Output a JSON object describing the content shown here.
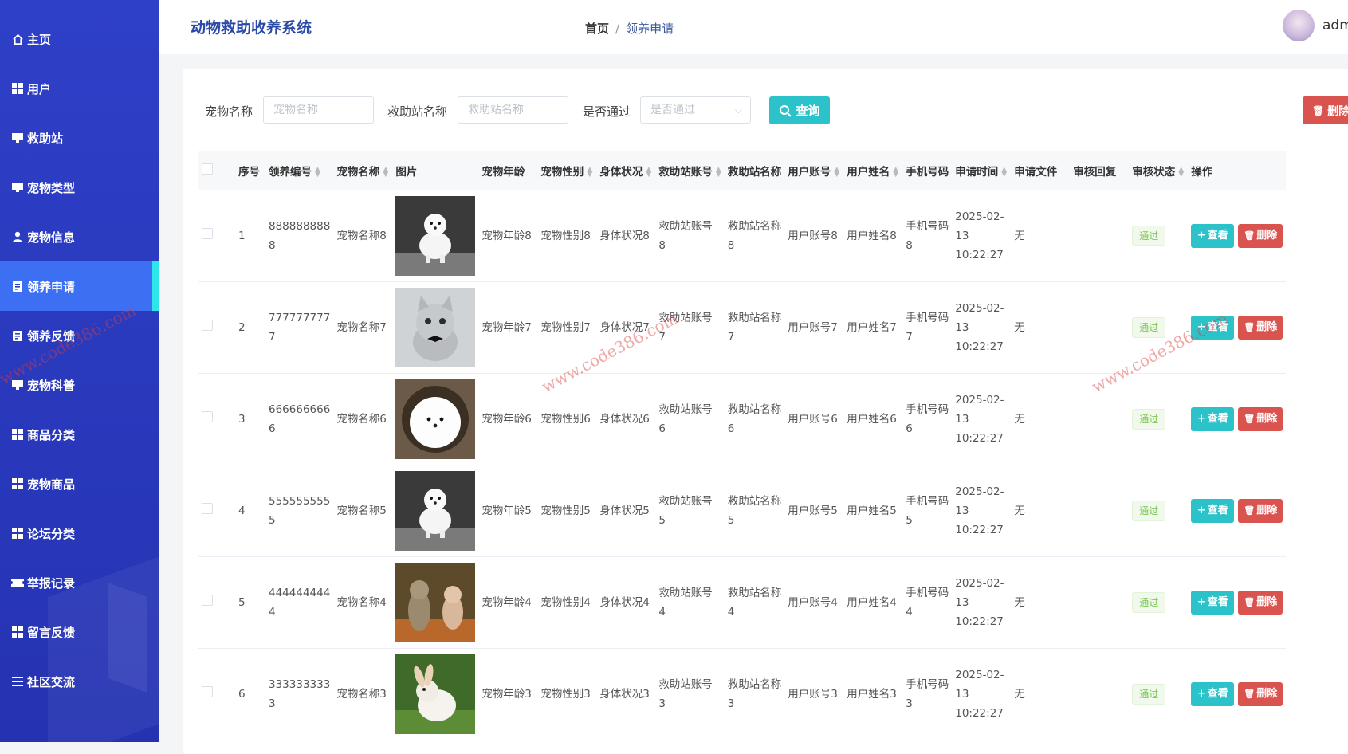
{
  "app": {
    "title": "动物救助收养系统",
    "username": "admin"
  },
  "breadcrumb": {
    "home": "首页",
    "separator": "/",
    "current": "领养申请"
  },
  "sidebar": {
    "items": [
      {
        "label": "主页",
        "icon": "home-icon"
      },
      {
        "label": "用户",
        "icon": "grid-icon"
      },
      {
        "label": "救助站",
        "icon": "monitor-icon"
      },
      {
        "label": "宠物类型",
        "icon": "monitor-icon"
      },
      {
        "label": "宠物信息",
        "icon": "user-icon"
      },
      {
        "label": "领养申请",
        "icon": "clipboard-icon",
        "active": true
      },
      {
        "label": "领养反馈",
        "icon": "clipboard-icon"
      },
      {
        "label": "宠物科普",
        "icon": "monitor-icon"
      },
      {
        "label": "商品分类",
        "icon": "grid-icon"
      },
      {
        "label": "宠物商品",
        "icon": "grid-icon"
      },
      {
        "label": "论坛分类",
        "icon": "grid-icon"
      },
      {
        "label": "举报记录",
        "icon": "ticket-icon"
      },
      {
        "label": "留言反馈",
        "icon": "grid-icon"
      },
      {
        "label": "社区交流",
        "icon": "list-icon"
      }
    ]
  },
  "search": {
    "pet_name_label": "宠物名称",
    "pet_name_placeholder": "宠物名称",
    "station_label": "救助站名称",
    "station_placeholder": "救助站名称",
    "pass_label": "是否通过",
    "pass_placeholder": "是否通过",
    "query_button": "查询",
    "batch_delete_button": "删除"
  },
  "table": {
    "headers": [
      "序号",
      "领养编号",
      "宠物名称",
      "图片",
      "宠物年龄",
      "宠物性别",
      "身体状况",
      "救助站账号",
      "救助站名称",
      "用户账号",
      "用户姓名",
      "手机号码",
      "申请时间",
      "申请文件",
      "审核回复",
      "审核状态",
      "操作"
    ],
    "rows": [
      {
        "index": "1",
        "code1": "888888888",
        "code2": "8",
        "pet_name": "宠物名称8",
        "image": "white-ferret",
        "age": "宠物年龄8",
        "gender": "宠物性别8",
        "health": "身体状况8",
        "station_acc1": "救助站账号",
        "station_acc2": "8",
        "station_name1": "救助站名称",
        "station_name2": "8",
        "user_acc": "用户账号8",
        "user_name": "用户姓名8",
        "phone1": "手机号码",
        "phone2": "8",
        "date": "2025-02-13",
        "time": "10:22:27",
        "file": "无",
        "reply": "",
        "status": "通过"
      },
      {
        "index": "2",
        "code1": "777777777",
        "code2": "7",
        "pet_name": "宠物名称7",
        "image": "grey-kitten",
        "age": "宠物年龄7",
        "gender": "宠物性别7",
        "health": "身体状况7",
        "station_acc1": "救助站账号",
        "station_acc2": "7",
        "station_name1": "救助站名称",
        "station_name2": "7",
        "user_acc": "用户账号7",
        "user_name": "用户姓名7",
        "phone1": "手机号码",
        "phone2": "7",
        "date": "2025-02-13",
        "time": "10:22:27",
        "file": "无",
        "reply": "",
        "status": "通过"
      },
      {
        "index": "3",
        "code1": "666666666",
        "code2": "6",
        "pet_name": "宠物名称6",
        "image": "white-pomeranian",
        "age": "宠物年龄6",
        "gender": "宠物性别6",
        "health": "身体状况6",
        "station_acc1": "救助站账号",
        "station_acc2": "6",
        "station_name1": "救助站名称",
        "station_name2": "6",
        "user_acc": "用户账号6",
        "user_name": "用户姓名6",
        "phone1": "手机号码",
        "phone2": "6",
        "date": "2025-02-13",
        "time": "10:22:27",
        "file": "无",
        "reply": "",
        "status": "通过"
      },
      {
        "index": "4",
        "code1": "555555555",
        "code2": "5",
        "pet_name": "宠物名称5",
        "image": "white-ferret",
        "age": "宠物年龄5",
        "gender": "宠物性别5",
        "health": "身体状况5",
        "station_acc1": "救助站账号",
        "station_acc2": "5",
        "station_name1": "救助站名称",
        "station_name2": "5",
        "user_acc": "用户账号5",
        "user_name": "用户姓名5",
        "phone1": "手机号码",
        "phone2": "5",
        "date": "2025-02-13",
        "time": "10:22:27",
        "file": "无",
        "reply": "",
        "status": "通过"
      },
      {
        "index": "5",
        "code1": "444444444",
        "code2": "4",
        "pet_name": "宠物名称4",
        "image": "tabby-kittens",
        "age": "宠物年龄4",
        "gender": "宠物性别4",
        "health": "身体状况4",
        "station_acc1": "救助站账号",
        "station_acc2": "4",
        "station_name1": "救助站名称",
        "station_name2": "4",
        "user_acc": "用户账号4",
        "user_name": "用户姓名4",
        "phone1": "手机号码",
        "phone2": "4",
        "date": "2025-02-13",
        "time": "10:22:27",
        "file": "无",
        "reply": "",
        "status": "通过"
      },
      {
        "index": "6",
        "code1": "333333333",
        "code2": "3",
        "pet_name": "宠物名称3",
        "image": "white-rabbit",
        "age": "宠物年龄3",
        "gender": "宠物性别3",
        "health": "身体状况3",
        "station_acc1": "救助站账号",
        "station_acc2": "3",
        "station_name1": "救助站名称",
        "station_name2": "3",
        "user_acc": "用户账号3",
        "user_name": "用户姓名3",
        "phone1": "手机号码",
        "phone2": "3",
        "date": "2025-02-13",
        "time": "10:22:27",
        "file": "无",
        "reply": "",
        "status": "通过"
      }
    ],
    "view_button": "查看",
    "delete_button": "删除"
  },
  "watermark": "www.code386.com",
  "colors": {
    "sidebar": "#2f40c8",
    "active": "#3d6ff2",
    "accent": "#2bc3c9",
    "danger": "#d9534f",
    "title": "#2b4aa8"
  }
}
